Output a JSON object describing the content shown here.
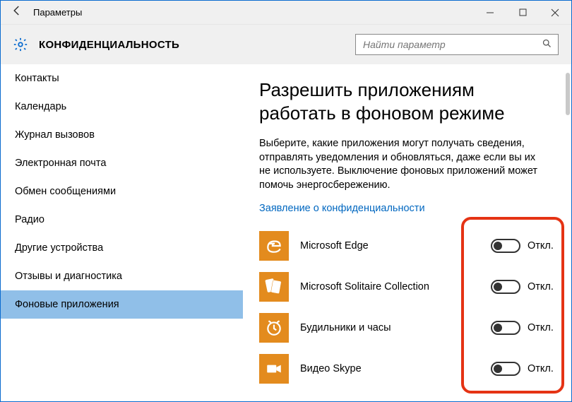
{
  "titlebar": {
    "title": "Параметры"
  },
  "header": {
    "page_title": "КОНФИДЕНЦИАЛЬНОСТЬ",
    "search_placeholder": "Найти параметр"
  },
  "sidebar": {
    "items": [
      {
        "label": "Контакты"
      },
      {
        "label": "Календарь"
      },
      {
        "label": "Журнал вызовов"
      },
      {
        "label": "Электронная почта"
      },
      {
        "label": "Обмен сообщениями"
      },
      {
        "label": "Радио"
      },
      {
        "label": "Другие устройства"
      },
      {
        "label": "Отзывы и диагностика"
      },
      {
        "label": "Фоновые приложения"
      }
    ],
    "selected_index": 8
  },
  "main": {
    "heading": "Разрешить приложениям работать в фоновом режиме",
    "description": "Выберите, какие приложения могут получать сведения, отправлять уведомления и обновляться, даже если вы их не используете. Выключение фоновых приложений может помочь энергосбережению.",
    "privacy_link": "Заявление о конфиденциальности",
    "apps": [
      {
        "name": "Microsoft Edge",
        "state_label": "Откл.",
        "icon": "edge"
      },
      {
        "name": "Microsoft Solitaire Collection",
        "state_label": "Откл.",
        "icon": "solitaire"
      },
      {
        "name": "Будильники и часы",
        "state_label": "Откл.",
        "icon": "alarm"
      },
      {
        "name": "Видео Skype",
        "state_label": "Откл.",
        "icon": "skype-video"
      }
    ]
  }
}
